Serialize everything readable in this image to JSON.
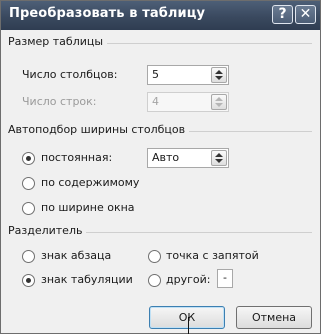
{
  "dialog": {
    "title": "Преобразовать в таблицу",
    "help_glyph": "?",
    "close_glyph": "✕"
  },
  "table_size": {
    "legend": "Размер таблицы",
    "columns_label": "Число столбцов:",
    "columns_value": "5",
    "rows_label": "Число строк:",
    "rows_value": "4"
  },
  "autofit": {
    "legend": "Автоподбор ширины столбцов",
    "fixed_label": "постоянная:",
    "fixed_value": "Авто",
    "contents_label": "по содержимому",
    "window_label": "по ширине окна",
    "selected": "fixed"
  },
  "separator": {
    "legend": "Разделитель",
    "paragraph_label": "знак абзаца",
    "semicolon_label": "точка с запятой",
    "tab_label": "знак табуляции",
    "other_label": "другой:",
    "other_value": "-",
    "selected": "tab"
  },
  "buttons": {
    "ok_label": "ОК",
    "cancel_label": "Отмена"
  }
}
